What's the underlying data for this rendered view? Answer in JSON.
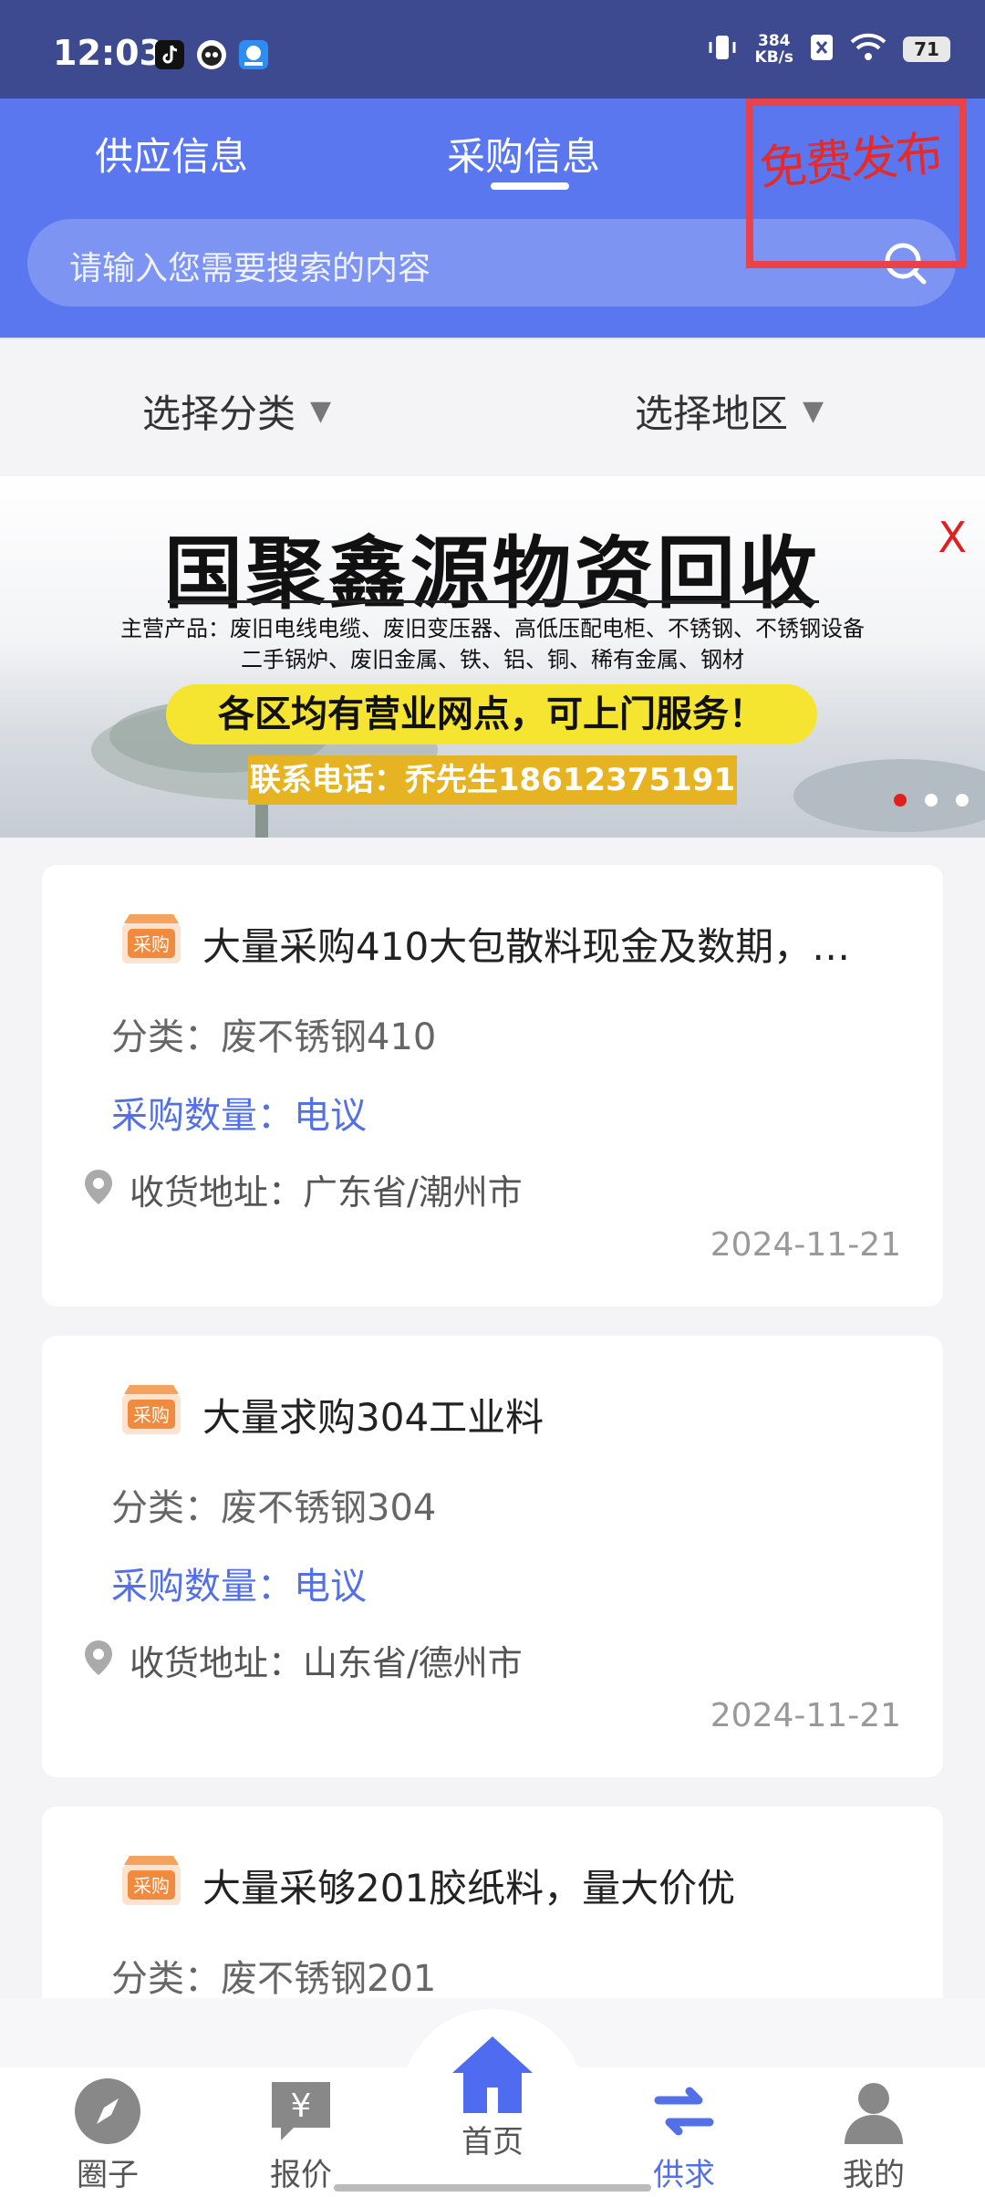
{
  "status_bar": {
    "time": "12:03",
    "net_speed_value": "384",
    "net_speed_unit": "KB/s",
    "battery": "71",
    "icons": [
      "tiktok-icon",
      "cat-app-icon",
      "app-icon",
      "vibrate-icon",
      "sim-off-icon",
      "wifi-icon",
      "battery-icon"
    ]
  },
  "header": {
    "tabs": [
      {
        "label": "供应信息",
        "active": false
      },
      {
        "label": "采购信息",
        "active": true
      }
    ],
    "search_placeholder": "请输入您需要搜索的内容",
    "publish_label": "免费发布",
    "accent_color": "#5a77f0"
  },
  "filters": {
    "category_label": "选择分类",
    "region_label": "选择地区"
  },
  "banner": {
    "title": "国聚鑫源物资回收",
    "products_line1": "主营产品：废旧电线电缆、废旧变压器、高低压配电柜、不锈钢、不锈钢设备",
    "products_line2": "二手锅炉、废旧金属、铁、铝、铜、稀有金属、钢材",
    "slogan": "各区均有营业网点，可上门服务！",
    "phone": "联系电话：乔先生18612375191",
    "close_label": "X",
    "slide_count": 3,
    "active_slide": 1
  },
  "listings": [
    {
      "badge": "采购",
      "title": "大量采购410大包散料现金及数期，…",
      "category": "分类：废不锈钢410",
      "quantity": "采购数量：电议",
      "address": "收货地址：广东省/潮州市",
      "date": "2024-11-21"
    },
    {
      "badge": "采购",
      "title": "大量求购304工业料",
      "category": "分类：废不锈钢304",
      "quantity": "采购数量：电议",
      "address": "收货地址：山东省/德州市",
      "date": "2024-11-21"
    },
    {
      "badge": "采购",
      "title": "大量采够201胶纸料，量大价优",
      "category": "分类：废不锈钢201",
      "quantity": "",
      "address": "",
      "date": ""
    }
  ],
  "bottom_nav": [
    {
      "label": "圈子",
      "icon": "compass-icon",
      "active": false
    },
    {
      "label": "报价",
      "icon": "yen-chat-icon",
      "active": false
    },
    {
      "label": "首页",
      "icon": "home-icon",
      "active": false
    },
    {
      "label": "供求",
      "icon": "exchange-icon",
      "active": true
    },
    {
      "label": "我的",
      "icon": "user-icon",
      "active": false
    }
  ]
}
